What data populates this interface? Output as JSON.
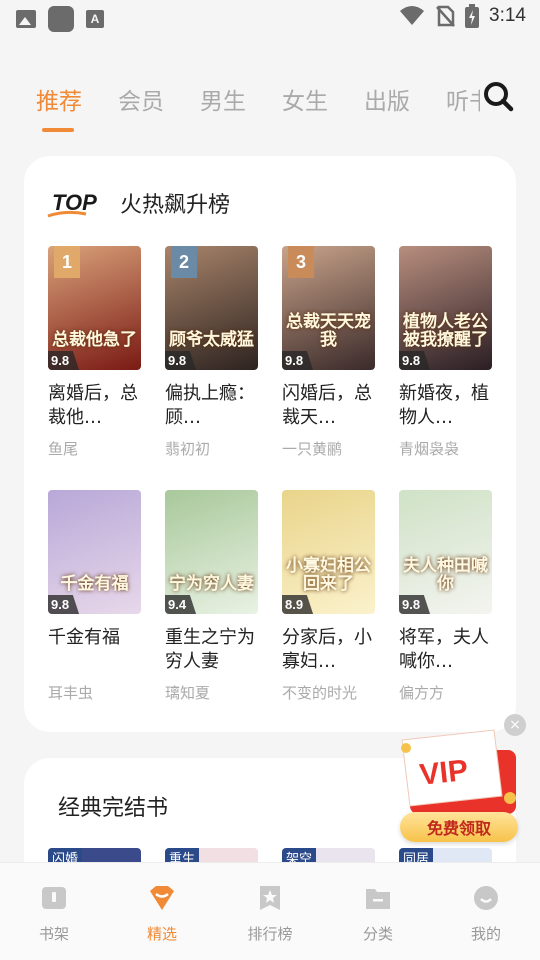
{
  "status_bar": {
    "time": "3:14"
  },
  "tabs": [
    {
      "label": "推荐",
      "active": true
    },
    {
      "label": "会员",
      "active": false
    },
    {
      "label": "男生",
      "active": false
    },
    {
      "label": "女生",
      "active": false
    },
    {
      "label": "出版",
      "active": false
    },
    {
      "label": "听书",
      "active": false
    }
  ],
  "hot_section": {
    "logo_text": "TOP",
    "title": "火热飙升榜",
    "books": [
      {
        "rank": "1",
        "score": "9.8",
        "cover_text": "总裁他急了",
        "title": "离婚后，总裁他…",
        "author": "鱼尾",
        "color1": "#7a1a14",
        "color2": "#d9a27a",
        "rank_color": "#e0a96a"
      },
      {
        "rank": "2",
        "score": "9.8",
        "cover_text": "顾爷太威猛",
        "title": "偏执上瘾：顾…",
        "author": "翡初初",
        "color1": "#2d2320",
        "color2": "#a8846a",
        "rank_color": "#6b8aa6"
      },
      {
        "rank": "3",
        "score": "9.8",
        "cover_text": "总裁天天宠我",
        "title": "闪婚后，总裁天…",
        "author": "一只黄鹂",
        "color1": "#3a2a2a",
        "color2": "#c9a38a",
        "rank_color": "#c98b5a"
      },
      {
        "rank": "",
        "score": "9.8",
        "cover_text": "植物人老公被我撩醒了",
        "title": "新婚夜，植物人…",
        "author": "青烟袅袅",
        "color1": "#2a1e24",
        "color2": "#b88e7e",
        "rank_color": ""
      },
      {
        "rank": "",
        "score": "9.8",
        "cover_text": "千金有福",
        "title": "千金有福",
        "author": "耳丰虫",
        "color1": "#e8d8ea",
        "color2": "#b7a8d8",
        "rank_color": ""
      },
      {
        "rank": "",
        "score": "9.4",
        "cover_text": "宁为穷人妻",
        "title": "重生之宁为穷人妻",
        "author": "璃知夏",
        "color1": "#e9f2e4",
        "color2": "#a8c89a",
        "rank_color": ""
      },
      {
        "rank": "",
        "score": "8.9",
        "cover_text": "小寡妇相公回来了",
        "title": "分家后，小寡妇…",
        "author": "不变的时光",
        "color1": "#fbf2cc",
        "color2": "#e9d48a",
        "rank_color": ""
      },
      {
        "rank": "",
        "score": "9.8",
        "cover_text": "夫人种田喊你",
        "title": "将军，夫人喊你…",
        "author": "偏方方",
        "color1": "#f4f4f0",
        "color2": "#cfe2c6",
        "rank_color": ""
      }
    ]
  },
  "classic_section": {
    "title": "经典完结书",
    "tags": [
      "闪婚",
      "重生",
      "架空",
      "同居"
    ]
  },
  "vip_popup": {
    "badge": "VIP",
    "button_label": "免费领取",
    "close": "×"
  },
  "bottom_nav": [
    {
      "label": "书架",
      "icon": "bookshelf-icon",
      "active": false
    },
    {
      "label": "精选",
      "icon": "featured-icon",
      "active": true
    },
    {
      "label": "排行榜",
      "icon": "ranking-icon",
      "active": false
    },
    {
      "label": "分类",
      "icon": "category-icon",
      "active": false
    },
    {
      "label": "我的",
      "icon": "profile-icon",
      "active": false
    }
  ],
  "colors": {
    "accent": "#f08a36",
    "inactive": "#aaaaaa"
  }
}
